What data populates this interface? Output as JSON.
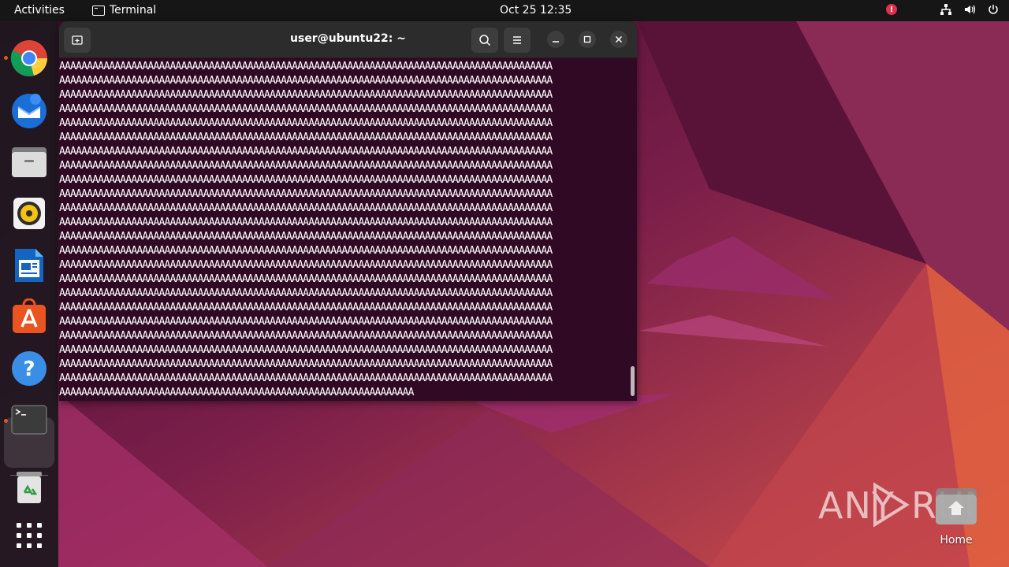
{
  "topbar": {
    "activities": "Activities",
    "app_name": "Terminal",
    "clock": "Oct 25  12:35",
    "alert_badge": "!"
  },
  "dock": {
    "items": [
      {
        "name": "chrome",
        "running": true
      },
      {
        "name": "thunderbird",
        "running": false
      },
      {
        "name": "files",
        "running": false
      },
      {
        "name": "rhythmbox",
        "running": false
      },
      {
        "name": "libreoffice-writer",
        "running": false
      },
      {
        "name": "ubuntu-software",
        "running": false
      },
      {
        "name": "help",
        "running": false
      },
      {
        "name": "terminal",
        "running": true
      },
      {
        "name": "trash",
        "running": false
      },
      {
        "name": "show-applications",
        "running": false
      }
    ]
  },
  "terminal": {
    "title": "user@ubuntu22: ~",
    "full_line": "AAAAAAAAAAAAAAAAAAAAAAAAAAAAAAAAAAAAAAAAAAAAAAAAAAAAAAAAAAAAAAAAAAAAAAAAAAAAAAAAAAAAAAAAA",
    "last_line": "AAAAAAAAAAAAAAAAAAAAAAAAAAAAAAAAAAAAAAAAAAAAAAAAAAAAAAAAAAAAAAAA",
    "full_line_count": 23
  },
  "desktop": {
    "home_label": "Home",
    "watermark": "ANY RUN"
  },
  "colors": {
    "accent": "#e95420",
    "terminal_bg": "#300a24",
    "titlebar_bg": "#2c2c2c",
    "topbar_bg": "#161616"
  }
}
